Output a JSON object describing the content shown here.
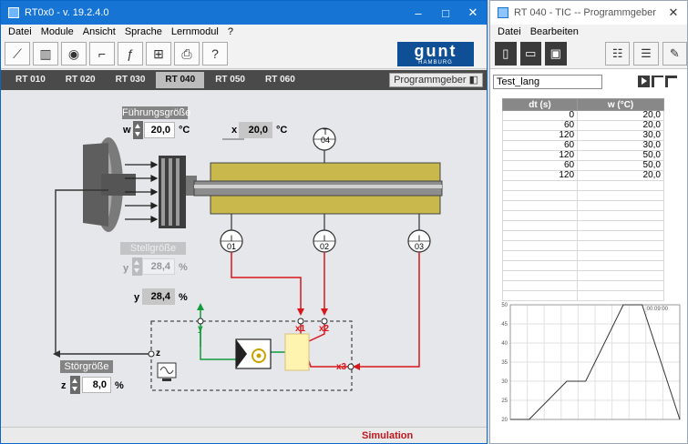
{
  "main": {
    "title": "RT0x0 - v. 19.2.4.0",
    "menu": [
      "Datei",
      "Module",
      "Ansicht",
      "Sprache",
      "Lernmodul",
      "?"
    ],
    "toolbar_icons": [
      "trend-plot-icon",
      "bar-chart-icon",
      "eye-plot-icon",
      "step-response-icon",
      "function-plot-icon",
      "network-icon",
      "print-icon",
      "help-icon"
    ],
    "logo_text": "gunt",
    "logo_sub": "HAMBURG",
    "tabs": [
      "RT 010",
      "RT 020",
      "RT 030",
      "RT 040",
      "RT 050",
      "RT 060"
    ],
    "active_tab": "RT 040",
    "program_button": "Programmgeber",
    "setpoint": {
      "label": "Führungsgröße",
      "symbol": "w",
      "value": "20,0",
      "unit": "°C"
    },
    "measured": {
      "symbol": "x",
      "value": "20,0",
      "unit": "°C"
    },
    "manipulated_disabled": {
      "label": "Stellgröße",
      "symbol": "y",
      "value": "28,4",
      "unit": "%"
    },
    "manipulated": {
      "symbol": "y",
      "value": "28,4",
      "unit": "%"
    },
    "disturbance": {
      "label": "Störgröße",
      "symbol": "z",
      "value": "8,0",
      "unit": "%"
    },
    "sensors": [
      "04",
      "01",
      "02",
      "03"
    ],
    "sensor_letters": {
      "top": "T",
      "bottom": "I"
    },
    "signals": {
      "x1": "x1",
      "x2": "x2",
      "x3": "x3",
      "y": "y",
      "z": "z"
    },
    "status": "Simulation"
  },
  "side": {
    "title": "RT 040 - TIC -- Programmgeber",
    "menu": [
      "Datei",
      "Bearbeiten"
    ],
    "program_name": "Test_lang",
    "table_headers": [
      "dt (s)",
      "w (°C)"
    ],
    "table_rows": [
      [
        "0",
        "20,0"
      ],
      [
        "60",
        "20,0"
      ],
      [
        "120",
        "30,0"
      ],
      [
        "60",
        "30,0"
      ],
      [
        "120",
        "50,0"
      ],
      [
        "60",
        "50,0"
      ],
      [
        "120",
        "20,0"
      ]
    ],
    "empty_rows": 12,
    "chart_time": "00:09:00"
  },
  "colors": {
    "titlebar": "#1574d4",
    "red_line": "#d8161b",
    "green_line": "#119b3a",
    "logo": "#0e4f96",
    "rod": "#c8b84a"
  },
  "chart_data": {
    "type": "line",
    "x": [
      0,
      60,
      180,
      240,
      360,
      420,
      540
    ],
    "values": [
      20,
      20,
      30,
      30,
      50,
      50,
      20
    ],
    "title": "",
    "xlabel": "",
    "ylabel": "",
    "ylim": [
      20,
      50
    ],
    "yticks": [
      20,
      25,
      30,
      35,
      40,
      45,
      50
    ],
    "grid": true
  }
}
